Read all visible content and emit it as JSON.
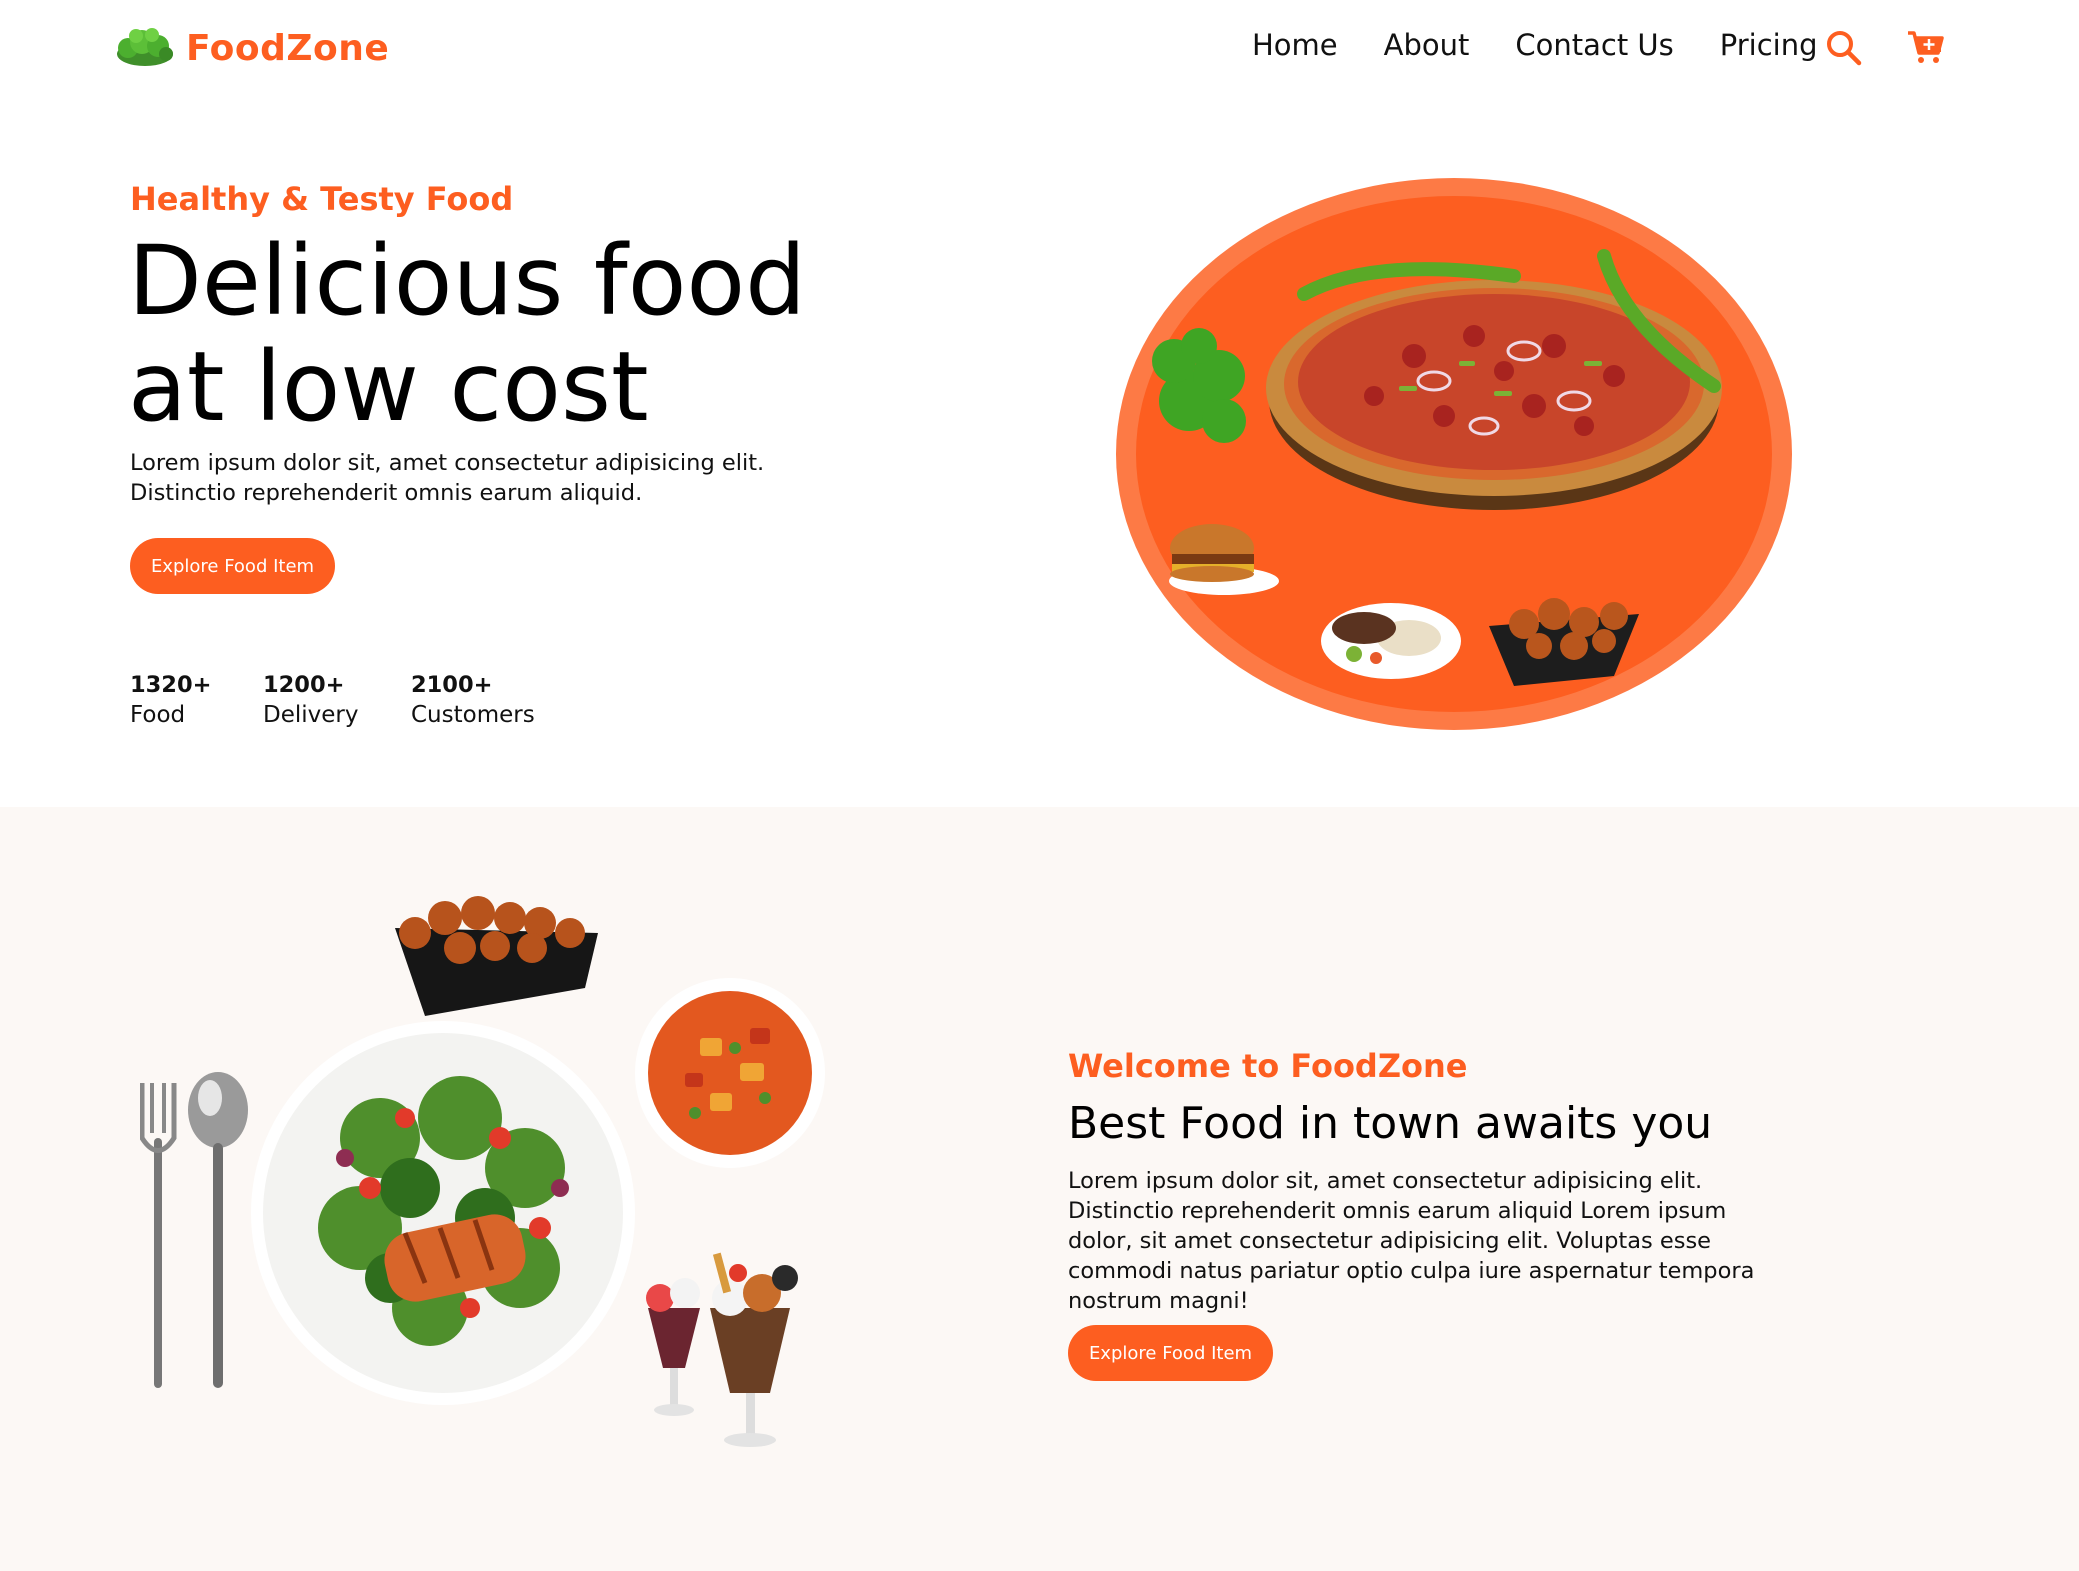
{
  "brand": {
    "name": "FoodZone",
    "logo_icon": "leaf-bush-icon",
    "accent": "#fd5e20"
  },
  "nav": {
    "links": [
      "Home",
      "About",
      "Contact Us",
      "Pricing"
    ],
    "search_icon": "search-icon",
    "cart_icon": "cart-icon"
  },
  "hero": {
    "tagline": "Healthy & Testy Food",
    "title_line1": "Delicious food",
    "title_line2": "at low cost",
    "description": "Lorem ipsum dolor sit, amet consectetur adipisicing elit. Distinctio reprehenderit omnis earum aliquid.",
    "button": "Explore Food Item",
    "stats": [
      {
        "value": "1320+",
        "label": "Food"
      },
      {
        "value": "1200+",
        "label": "Delivery"
      },
      {
        "value": "2100+",
        "label": "Customers"
      }
    ]
  },
  "welcome": {
    "tagline": "Welcome to FoodZone",
    "title": "Best Food in town awaits you",
    "description": "Lorem ipsum dolor sit, amet consectetur adipisicing elit. Distinctio reprehenderit omnis earum aliquid Lorem ipsum dolor, sit amet consectetur adipisicing elit. Voluptas esse commodi natus pariatur optio culpa iure aspernatur tempora nostrum magni!",
    "button": "Explore Food Item"
  }
}
